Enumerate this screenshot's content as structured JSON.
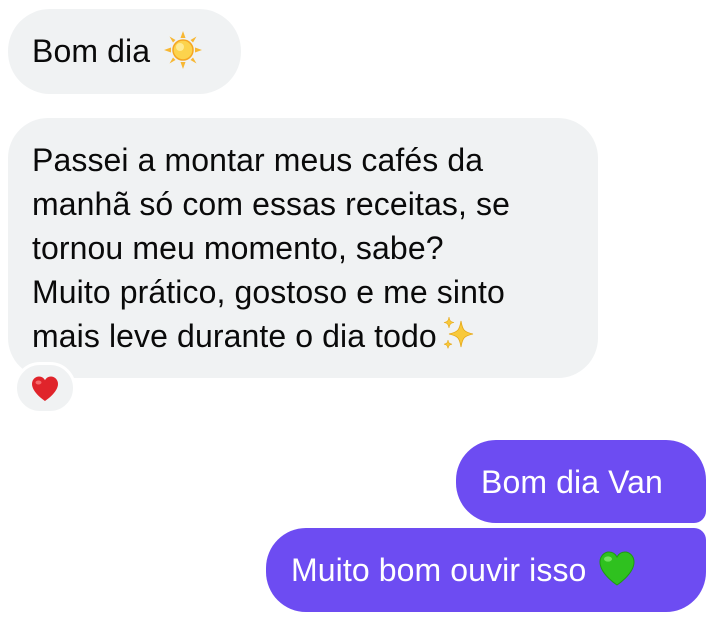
{
  "conversation": {
    "messages": [
      {
        "sender": "incoming",
        "text": "Bom dia",
        "emoji": "sun-icon"
      },
      {
        "sender": "incoming",
        "lines": [
          "Passei a montar meus cafés da",
          "manhã só com essas receitas, se",
          "tornou meu momento, sabe?",
          "Muito prático, gostoso e me sinto",
          "mais leve durante o dia todo"
        ],
        "emoji": "sparkles-icon",
        "reaction": "red-heart-icon"
      },
      {
        "sender": "outgoing",
        "text": "Bom dia Van"
      },
      {
        "sender": "outgoing",
        "text": "Muito bom ouvir isso",
        "emoji": "green-heart-icon"
      }
    ]
  },
  "colors": {
    "incoming_bubble": "#f0f2f3",
    "outgoing_bubble": "#6d4cf2",
    "incoming_text": "#0a0a0a",
    "outgoing_text": "#ffffff"
  }
}
